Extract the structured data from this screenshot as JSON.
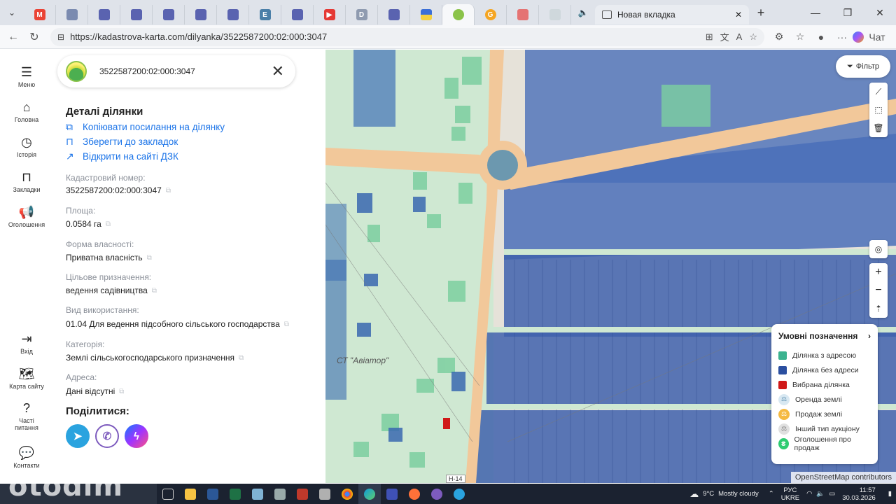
{
  "browser": {
    "new_tab_title": "Новая вкладка",
    "url": "https://kadastrova-karta.com/dilyanka/3522587200:02:000:3047",
    "chat_label": "Чат"
  },
  "nav": {
    "menu": "Меню",
    "home": "Головна",
    "history": "Історія",
    "bookmarks": "Закладки",
    "ads": "Оголошення",
    "login": "Вхід",
    "sitemap": "Карта сайту",
    "faq": "Часті питання",
    "contacts": "Контакти"
  },
  "search": {
    "value": "3522587200:02:000:3047"
  },
  "details": {
    "title": "Деталі ділянки",
    "copy_link": "Копіювати посилання на ділянку",
    "save_bookmark": "Зберегти до закладок",
    "open_dzk": "Відкрити на сайті ДЗК",
    "fields": [
      {
        "label": "Кадастровий номер:",
        "value": "3522587200:02:000:3047"
      },
      {
        "label": "Площа:",
        "value": "0.0584 га"
      },
      {
        "label": "Форма власності:",
        "value": "Приватна власність"
      },
      {
        "label": "Цільове призначення:",
        "value": "ведення садівництва"
      },
      {
        "label": "Вид використання:",
        "value": "01.04 Для ведення підсобного сільського господарства"
      },
      {
        "label": "Категорія:",
        "value": "Землі сільськогосподарського призначення"
      },
      {
        "label": "Адреса:",
        "value": "Дані відсутні"
      }
    ],
    "share_title": "Поділитися:"
  },
  "map": {
    "filter": "Фільтр",
    "place_label": "СТ \"Авіатор\"",
    "road_label": "Н-14",
    "attribution": "OpenStreetMap contributors",
    "legend": {
      "title": "Умовні позначення",
      "items": [
        {
          "label": "Ділянка з адресою",
          "color": "#3bb38f"
        },
        {
          "label": "Ділянка без адреси",
          "color": "#2b4fa0"
        },
        {
          "label": "Вибрана ділянка",
          "color": "#d01818"
        },
        {
          "label": "Оренда землі",
          "color": "#b9d6e6"
        },
        {
          "label": "Продаж землі",
          "color": "#f5b942"
        },
        {
          "label": "Інший тип аукціону",
          "color": "#c9c9c9"
        },
        {
          "label": "Оголошення про продаж",
          "color": "#2ecc71"
        }
      ]
    }
  },
  "taskbar": {
    "weather_temp": "9°C",
    "weather_text": "Mostly cloudy",
    "lang_top": "РУС",
    "lang_bottom": "UKRE",
    "time": "11:57",
    "date": "30.03.2026"
  },
  "watermark": "otodim"
}
